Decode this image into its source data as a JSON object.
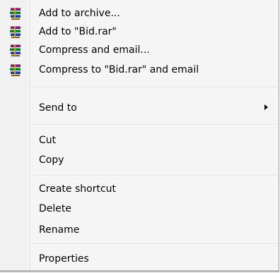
{
  "menu": {
    "items": [
      {
        "label": "Add to archive...",
        "icon": "winrar-icon"
      },
      {
        "label": "Add to \"Bid.rar\"",
        "icon": "winrar-icon"
      },
      {
        "label": "Compress and email...",
        "icon": "winrar-icon"
      },
      {
        "label": "Compress to \"Bid.rar\" and email",
        "icon": "winrar-icon"
      },
      {
        "label": "Send to",
        "icon": "submenu-arrow-icon"
      },
      {
        "label": "Cut"
      },
      {
        "label": "Copy"
      },
      {
        "label": "Create shortcut"
      },
      {
        "label": "Delete"
      },
      {
        "label": "Rename"
      },
      {
        "label": "Properties"
      }
    ]
  }
}
